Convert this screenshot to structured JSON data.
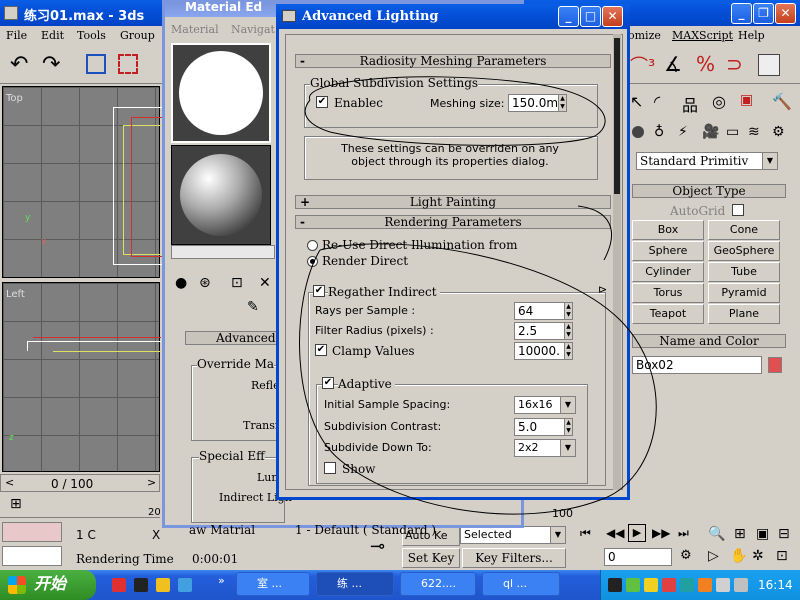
{
  "max": {
    "title": "练习01.max - 3ds",
    "menu": [
      "File",
      "Edit",
      "Tools",
      "Group"
    ],
    "menu_right": [
      "omize",
      "MAXScript",
      "Help"
    ],
    "vp_top": "Top",
    "vp_left": "Left",
    "frame": "0 / 100",
    "status_left": "1 C",
    "status_x": "X",
    "render_time_label": "Rendering Time",
    "render_time": "0:00:01",
    "ruler": "100",
    "ruler2": "20"
  },
  "material": {
    "title": "Material Ed",
    "menu": [
      "Material",
      "Navigat"
    ],
    "rollout": "Advanced",
    "override": "Override Ma",
    "refle": "Refle",
    "transm": "Transm",
    "special": "Special Eff",
    "lum": "Lum",
    "indirect": "Indirect Ligh",
    "bottom": [
      "aw Matrial",
      "1 - Default ( Standard )"
    ]
  },
  "cmd": {
    "dropdown": "Standard Primitiv",
    "object_type": "Object Type",
    "autogrid": "AutoGrid",
    "buttons": [
      "Box",
      "Cone",
      "Sphere",
      "GeoSphere",
      "Cylinder",
      "Tube",
      "Torus",
      "Pyramid",
      "Teapot",
      "Plane"
    ],
    "name_color": "Name and Color",
    "name": "Box02",
    "color": "#e05050"
  },
  "anim": {
    "set_key": "Set Key",
    "key_filters": "Key Filters...",
    "auto_key": "Auto Ke",
    "selected": "Selected",
    "frame": "0"
  },
  "dialog": {
    "title": "Advanced Lighting",
    "radiosity_meshing": "Radiosity Meshing Parameters",
    "global_subdiv": "Global Subdivision Settings",
    "enabled": "Enablec",
    "meshing_size_label": "Meshing size:",
    "meshing_size": "150.0m",
    "override_note": "These settings can be overriden on any object through its properties dialog.",
    "light_painting": "Light Painting",
    "rendering_params": "Rendering Parameters",
    "reuse": "Re-Use Direct Illumination from",
    "render_direct": "Render Direct",
    "regather": "Regather Indirect",
    "rays_label": "Rays per Sample :",
    "rays": "64",
    "filter_label": "Filter Radius (pixels) :",
    "filter": "2.5",
    "clamp_label": "Clamp Values",
    "clamp": "10000.",
    "adaptive": "Adaptive",
    "initial_label": "Initial Sample Spacing:",
    "initial": "16x16",
    "contrast_label": "Subdivision Contrast:",
    "contrast": "5.0",
    "subdivide_label": "Subdivide Down To:",
    "subdivide": "2x2",
    "show": "Show"
  },
  "taskbar": {
    "start": "开始",
    "items": [
      "室 ...",
      "练 ...",
      "622....",
      "ql ..."
    ],
    "clock": "16:14"
  }
}
